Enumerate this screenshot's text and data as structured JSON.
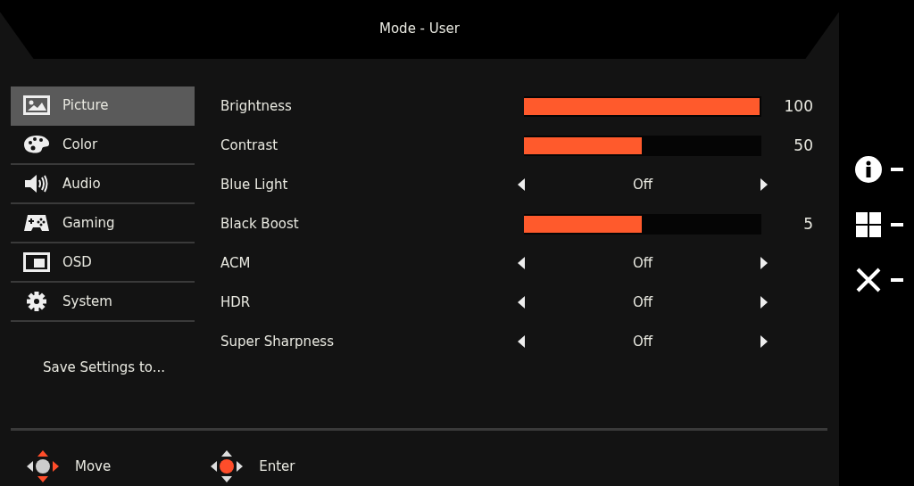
{
  "title": "Mode - User",
  "menu": [
    {
      "label": "Picture",
      "kind": "picture",
      "selected": true
    },
    {
      "label": "Color",
      "kind": "palette",
      "selected": false
    },
    {
      "label": "Audio",
      "kind": "speaker",
      "selected": false
    },
    {
      "label": "Gaming",
      "kind": "gamepad",
      "selected": false
    },
    {
      "label": "OSD",
      "kind": "window",
      "selected": false
    },
    {
      "label": "System",
      "kind": "gear",
      "selected": false
    }
  ],
  "save_settings": "Save Settings to...",
  "settings": [
    {
      "kind": "bar",
      "label": "Brightness",
      "level": 1,
      "reading": "100"
    },
    {
      "kind": "bar",
      "label": "Contrast",
      "level": 0.5,
      "reading": "50"
    },
    {
      "kind": "choice",
      "label": "Blue Light",
      "value": "Off"
    },
    {
      "kind": "bar",
      "label": "Black Boost",
      "level": 0.5,
      "reading": "5"
    },
    {
      "kind": "choice",
      "label": "ACM",
      "value": "Off"
    },
    {
      "kind": "choice",
      "label": "HDR",
      "value": "Off"
    },
    {
      "kind": "choice",
      "label": "Super Sharpness",
      "value": "Off"
    }
  ],
  "hints": [
    {
      "kind": "move",
      "label": "Move"
    },
    {
      "kind": "enter",
      "label": "Enter"
    }
  ]
}
